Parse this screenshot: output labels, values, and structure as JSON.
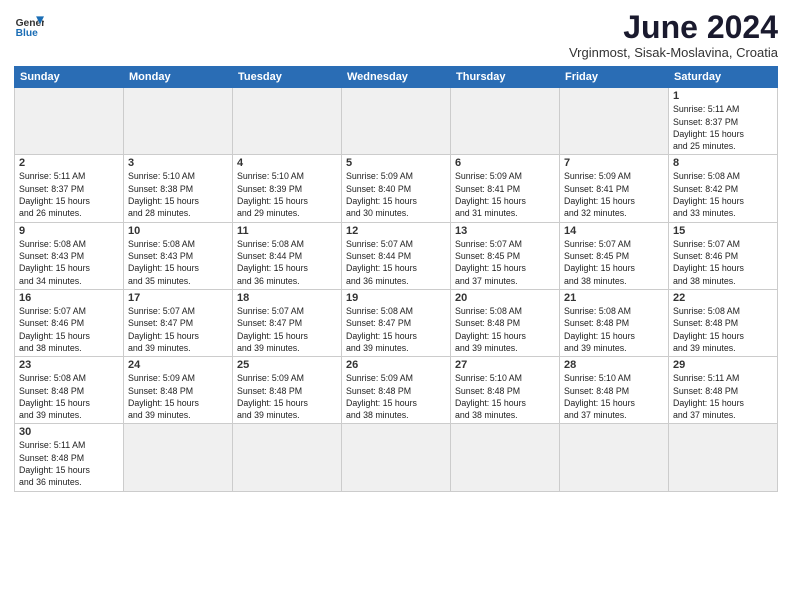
{
  "header": {
    "logo_general": "General",
    "logo_blue": "Blue",
    "month_title": "June 2024",
    "subtitle": "Vrginmost, Sisak-Moslavina, Croatia"
  },
  "weekdays": [
    "Sunday",
    "Monday",
    "Tuesday",
    "Wednesday",
    "Thursday",
    "Friday",
    "Saturday"
  ],
  "weeks": [
    [
      {
        "day": "",
        "info": ""
      },
      {
        "day": "",
        "info": ""
      },
      {
        "day": "",
        "info": ""
      },
      {
        "day": "",
        "info": ""
      },
      {
        "day": "",
        "info": ""
      },
      {
        "day": "",
        "info": ""
      },
      {
        "day": "1",
        "info": "Sunrise: 5:11 AM\nSunset: 8:37 PM\nDaylight: 15 hours\nand 25 minutes."
      }
    ],
    [
      {
        "day": "2",
        "info": "Sunrise: 5:11 AM\nSunset: 8:37 PM\nDaylight: 15 hours\nand 26 minutes."
      },
      {
        "day": "3",
        "info": "Sunrise: 5:10 AM\nSunset: 8:38 PM\nDaylight: 15 hours\nand 28 minutes."
      },
      {
        "day": "4",
        "info": "Sunrise: 5:10 AM\nSunset: 8:39 PM\nDaylight: 15 hours\nand 29 minutes."
      },
      {
        "day": "5",
        "info": "Sunrise: 5:09 AM\nSunset: 8:40 PM\nDaylight: 15 hours\nand 30 minutes."
      },
      {
        "day": "6",
        "info": "Sunrise: 5:09 AM\nSunset: 8:41 PM\nDaylight: 15 hours\nand 31 minutes."
      },
      {
        "day": "7",
        "info": "Sunrise: 5:09 AM\nSunset: 8:41 PM\nDaylight: 15 hours\nand 32 minutes."
      },
      {
        "day": "8",
        "info": "Sunrise: 5:08 AM\nSunset: 8:42 PM\nDaylight: 15 hours\nand 33 minutes."
      }
    ],
    [
      {
        "day": "9",
        "info": "Sunrise: 5:08 AM\nSunset: 8:43 PM\nDaylight: 15 hours\nand 34 minutes."
      },
      {
        "day": "10",
        "info": "Sunrise: 5:08 AM\nSunset: 8:43 PM\nDaylight: 15 hours\nand 35 minutes."
      },
      {
        "day": "11",
        "info": "Sunrise: 5:08 AM\nSunset: 8:44 PM\nDaylight: 15 hours\nand 36 minutes."
      },
      {
        "day": "12",
        "info": "Sunrise: 5:07 AM\nSunset: 8:44 PM\nDaylight: 15 hours\nand 36 minutes."
      },
      {
        "day": "13",
        "info": "Sunrise: 5:07 AM\nSunset: 8:45 PM\nDaylight: 15 hours\nand 37 minutes."
      },
      {
        "day": "14",
        "info": "Sunrise: 5:07 AM\nSunset: 8:45 PM\nDaylight: 15 hours\nand 38 minutes."
      },
      {
        "day": "15",
        "info": "Sunrise: 5:07 AM\nSunset: 8:46 PM\nDaylight: 15 hours\nand 38 minutes."
      }
    ],
    [
      {
        "day": "16",
        "info": "Sunrise: 5:07 AM\nSunset: 8:46 PM\nDaylight: 15 hours\nand 38 minutes."
      },
      {
        "day": "17",
        "info": "Sunrise: 5:07 AM\nSunset: 8:47 PM\nDaylight: 15 hours\nand 39 minutes."
      },
      {
        "day": "18",
        "info": "Sunrise: 5:07 AM\nSunset: 8:47 PM\nDaylight: 15 hours\nand 39 minutes."
      },
      {
        "day": "19",
        "info": "Sunrise: 5:08 AM\nSunset: 8:47 PM\nDaylight: 15 hours\nand 39 minutes."
      },
      {
        "day": "20",
        "info": "Sunrise: 5:08 AM\nSunset: 8:48 PM\nDaylight: 15 hours\nand 39 minutes."
      },
      {
        "day": "21",
        "info": "Sunrise: 5:08 AM\nSunset: 8:48 PM\nDaylight: 15 hours\nand 39 minutes."
      },
      {
        "day": "22",
        "info": "Sunrise: 5:08 AM\nSunset: 8:48 PM\nDaylight: 15 hours\nand 39 minutes."
      }
    ],
    [
      {
        "day": "23",
        "info": "Sunrise: 5:08 AM\nSunset: 8:48 PM\nDaylight: 15 hours\nand 39 minutes."
      },
      {
        "day": "24",
        "info": "Sunrise: 5:09 AM\nSunset: 8:48 PM\nDaylight: 15 hours\nand 39 minutes."
      },
      {
        "day": "25",
        "info": "Sunrise: 5:09 AM\nSunset: 8:48 PM\nDaylight: 15 hours\nand 39 minutes."
      },
      {
        "day": "26",
        "info": "Sunrise: 5:09 AM\nSunset: 8:48 PM\nDaylight: 15 hours\nand 38 minutes."
      },
      {
        "day": "27",
        "info": "Sunrise: 5:10 AM\nSunset: 8:48 PM\nDaylight: 15 hours\nand 38 minutes."
      },
      {
        "day": "28",
        "info": "Sunrise: 5:10 AM\nSunset: 8:48 PM\nDaylight: 15 hours\nand 37 minutes."
      },
      {
        "day": "29",
        "info": "Sunrise: 5:11 AM\nSunset: 8:48 PM\nDaylight: 15 hours\nand 37 minutes."
      }
    ],
    [
      {
        "day": "30",
        "info": "Sunrise: 5:11 AM\nSunset: 8:48 PM\nDaylight: 15 hours\nand 36 minutes."
      },
      {
        "day": "",
        "info": ""
      },
      {
        "day": "",
        "info": ""
      },
      {
        "day": "",
        "info": ""
      },
      {
        "day": "",
        "info": ""
      },
      {
        "day": "",
        "info": ""
      },
      {
        "day": "",
        "info": ""
      }
    ]
  ]
}
